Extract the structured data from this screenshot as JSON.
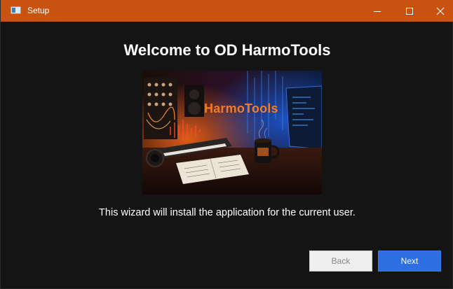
{
  "window": {
    "title": "Setup"
  },
  "wizard": {
    "heading": "Welcome to OD HarmoTools",
    "banner": {
      "logo_text": "HarmoTools"
    },
    "description": "This wizard will install the application for the current user."
  },
  "buttons": {
    "back_label": "Back",
    "back_enabled": false,
    "next_label": "Next"
  },
  "colors": {
    "titlebar": "#c8520f",
    "window_bg": "#141414",
    "next_button": "#2d6ee3",
    "banner_accent": "#f57b22"
  },
  "icons": {
    "app": "setup-window-icon",
    "minimize": "minimize-icon",
    "maximize": "maximize-icon",
    "close": "close-icon"
  }
}
